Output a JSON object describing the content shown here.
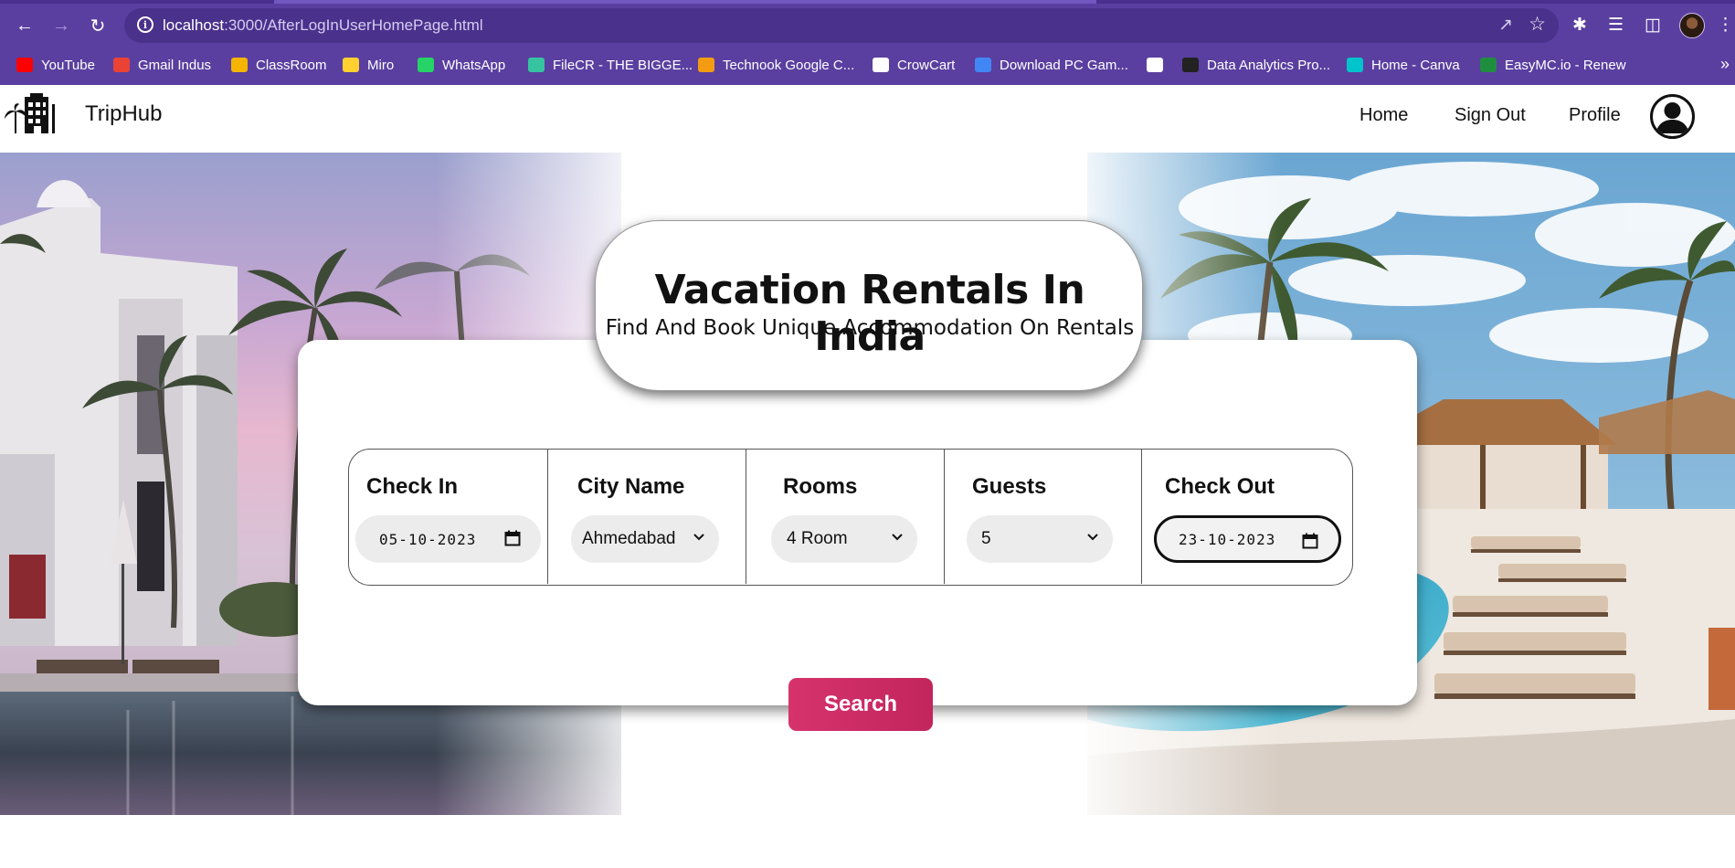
{
  "browser": {
    "url_host": "localhost",
    "url_rest": ":3000/AfterLogInUserHomePage.html",
    "bookmarks": [
      {
        "label": "YouTube",
        "icon": "youtube-icon",
        "color": "#ff0000"
      },
      {
        "label": "Gmail Indus",
        "icon": "gmail-icon",
        "color": "#ea4335"
      },
      {
        "label": "ClassRoom",
        "icon": "classroom-icon",
        "color": "#f4b400"
      },
      {
        "label": "Miro",
        "icon": "miro-icon",
        "color": "#ffd02f"
      },
      {
        "label": "WhatsApp",
        "icon": "whatsapp-icon",
        "color": "#25d366"
      },
      {
        "label": "FileCR - THE BIGGE...",
        "icon": "filecr-icon",
        "color": "#36c3a0"
      },
      {
        "label": "Technook Google C...",
        "icon": "technook-icon",
        "color": "#f39c12"
      },
      {
        "label": "CrowCart",
        "icon": "cart-icon",
        "color": "#ffffff"
      },
      {
        "label": "Download PC Gam...",
        "icon": "google-icon",
        "color": "#4285f4"
      },
      {
        "label": "",
        "icon": "globe-icon",
        "color": "#ffffff"
      },
      {
        "label": "Data Analytics Pro...",
        "icon": "analytics-icon",
        "color": "#222222"
      },
      {
        "label": "Home - Canva",
        "icon": "canva-icon",
        "color": "#00c4cc"
      },
      {
        "label": "EasyMC.io - Renew",
        "icon": "easymc-icon",
        "color": "#1e8e3e"
      }
    ],
    "more": "»"
  },
  "navbar": {
    "brand": "TripHub",
    "links": {
      "home": "Home",
      "signout": "Sign Out",
      "profile": "Profile"
    }
  },
  "hero": {
    "title": "Vacation Rentals In India",
    "subtitle": "Find And Book Unique Accommodation On Rentals"
  },
  "form": {
    "checkin": {
      "label": "Check In",
      "value": "05-10-2023"
    },
    "city": {
      "label": "City Name",
      "value": "Ahmedabad"
    },
    "rooms": {
      "label": "Rooms",
      "value": "4 Room"
    },
    "guests": {
      "label": "Guests",
      "value": "5"
    },
    "checkout": {
      "label": "Check Out",
      "value": "23-10-2023"
    },
    "search_label": "Search"
  },
  "colors": {
    "chrome": "#5a3fa0",
    "accent": "#d6336c"
  }
}
